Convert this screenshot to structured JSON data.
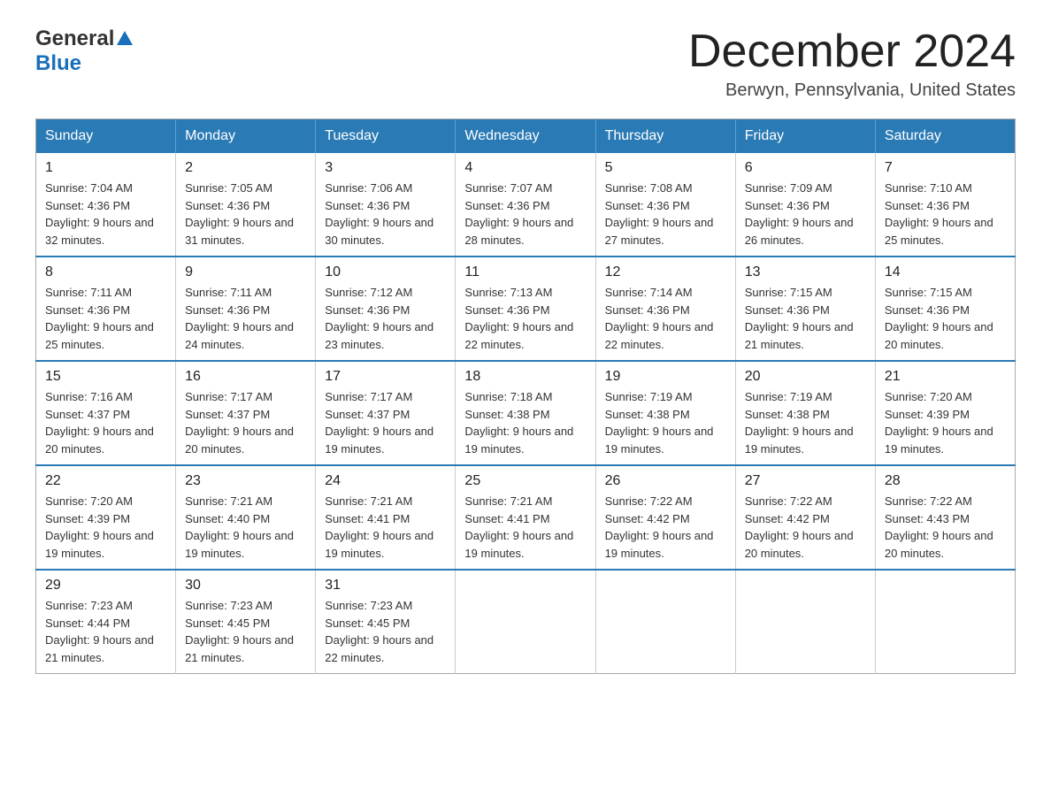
{
  "header": {
    "logo_general": "General",
    "logo_blue": "Blue",
    "month_title": "December 2024",
    "location": "Berwyn, Pennsylvania, United States"
  },
  "weekdays": [
    "Sunday",
    "Monday",
    "Tuesday",
    "Wednesday",
    "Thursday",
    "Friday",
    "Saturday"
  ],
  "weeks": [
    [
      {
        "day": "1",
        "sunrise": "7:04 AM",
        "sunset": "4:36 PM",
        "daylight": "9 hours and 32 minutes."
      },
      {
        "day": "2",
        "sunrise": "7:05 AM",
        "sunset": "4:36 PM",
        "daylight": "9 hours and 31 minutes."
      },
      {
        "day": "3",
        "sunrise": "7:06 AM",
        "sunset": "4:36 PM",
        "daylight": "9 hours and 30 minutes."
      },
      {
        "day": "4",
        "sunrise": "7:07 AM",
        "sunset": "4:36 PM",
        "daylight": "9 hours and 28 minutes."
      },
      {
        "day": "5",
        "sunrise": "7:08 AM",
        "sunset": "4:36 PM",
        "daylight": "9 hours and 27 minutes."
      },
      {
        "day": "6",
        "sunrise": "7:09 AM",
        "sunset": "4:36 PM",
        "daylight": "9 hours and 26 minutes."
      },
      {
        "day": "7",
        "sunrise": "7:10 AM",
        "sunset": "4:36 PM",
        "daylight": "9 hours and 25 minutes."
      }
    ],
    [
      {
        "day": "8",
        "sunrise": "7:11 AM",
        "sunset": "4:36 PM",
        "daylight": "9 hours and 25 minutes."
      },
      {
        "day": "9",
        "sunrise": "7:11 AM",
        "sunset": "4:36 PM",
        "daylight": "9 hours and 24 minutes."
      },
      {
        "day": "10",
        "sunrise": "7:12 AM",
        "sunset": "4:36 PM",
        "daylight": "9 hours and 23 minutes."
      },
      {
        "day": "11",
        "sunrise": "7:13 AM",
        "sunset": "4:36 PM",
        "daylight": "9 hours and 22 minutes."
      },
      {
        "day": "12",
        "sunrise": "7:14 AM",
        "sunset": "4:36 PM",
        "daylight": "9 hours and 22 minutes."
      },
      {
        "day": "13",
        "sunrise": "7:15 AM",
        "sunset": "4:36 PM",
        "daylight": "9 hours and 21 minutes."
      },
      {
        "day": "14",
        "sunrise": "7:15 AM",
        "sunset": "4:36 PM",
        "daylight": "9 hours and 20 minutes."
      }
    ],
    [
      {
        "day": "15",
        "sunrise": "7:16 AM",
        "sunset": "4:37 PM",
        "daylight": "9 hours and 20 minutes."
      },
      {
        "day": "16",
        "sunrise": "7:17 AM",
        "sunset": "4:37 PM",
        "daylight": "9 hours and 20 minutes."
      },
      {
        "day": "17",
        "sunrise": "7:17 AM",
        "sunset": "4:37 PM",
        "daylight": "9 hours and 19 minutes."
      },
      {
        "day": "18",
        "sunrise": "7:18 AM",
        "sunset": "4:38 PM",
        "daylight": "9 hours and 19 minutes."
      },
      {
        "day": "19",
        "sunrise": "7:19 AM",
        "sunset": "4:38 PM",
        "daylight": "9 hours and 19 minutes."
      },
      {
        "day": "20",
        "sunrise": "7:19 AM",
        "sunset": "4:38 PM",
        "daylight": "9 hours and 19 minutes."
      },
      {
        "day": "21",
        "sunrise": "7:20 AM",
        "sunset": "4:39 PM",
        "daylight": "9 hours and 19 minutes."
      }
    ],
    [
      {
        "day": "22",
        "sunrise": "7:20 AM",
        "sunset": "4:39 PM",
        "daylight": "9 hours and 19 minutes."
      },
      {
        "day": "23",
        "sunrise": "7:21 AM",
        "sunset": "4:40 PM",
        "daylight": "9 hours and 19 minutes."
      },
      {
        "day": "24",
        "sunrise": "7:21 AM",
        "sunset": "4:41 PM",
        "daylight": "9 hours and 19 minutes."
      },
      {
        "day": "25",
        "sunrise": "7:21 AM",
        "sunset": "4:41 PM",
        "daylight": "9 hours and 19 minutes."
      },
      {
        "day": "26",
        "sunrise": "7:22 AM",
        "sunset": "4:42 PM",
        "daylight": "9 hours and 19 minutes."
      },
      {
        "day": "27",
        "sunrise": "7:22 AM",
        "sunset": "4:42 PM",
        "daylight": "9 hours and 20 minutes."
      },
      {
        "day": "28",
        "sunrise": "7:22 AM",
        "sunset": "4:43 PM",
        "daylight": "9 hours and 20 minutes."
      }
    ],
    [
      {
        "day": "29",
        "sunrise": "7:23 AM",
        "sunset": "4:44 PM",
        "daylight": "9 hours and 21 minutes."
      },
      {
        "day": "30",
        "sunrise": "7:23 AM",
        "sunset": "4:45 PM",
        "daylight": "9 hours and 21 minutes."
      },
      {
        "day": "31",
        "sunrise": "7:23 AM",
        "sunset": "4:45 PM",
        "daylight": "9 hours and 22 minutes."
      },
      null,
      null,
      null,
      null
    ]
  ],
  "labels": {
    "sunrise": "Sunrise:",
    "sunset": "Sunset:",
    "daylight": "Daylight:"
  }
}
